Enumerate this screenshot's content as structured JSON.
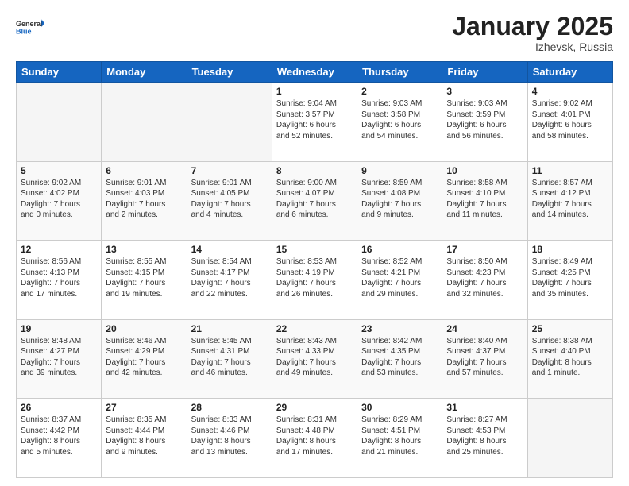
{
  "header": {
    "logo_general": "General",
    "logo_blue": "Blue",
    "month_title": "January 2025",
    "location": "Izhevsk, Russia"
  },
  "weekdays": [
    "Sunday",
    "Monday",
    "Tuesday",
    "Wednesday",
    "Thursday",
    "Friday",
    "Saturday"
  ],
  "weeks": [
    [
      {
        "day": "",
        "info": "",
        "empty": true
      },
      {
        "day": "",
        "info": "",
        "empty": true
      },
      {
        "day": "",
        "info": "",
        "empty": true
      },
      {
        "day": "1",
        "info": "Sunrise: 9:04 AM\nSunset: 3:57 PM\nDaylight: 6 hours\nand 52 minutes."
      },
      {
        "day": "2",
        "info": "Sunrise: 9:03 AM\nSunset: 3:58 PM\nDaylight: 6 hours\nand 54 minutes."
      },
      {
        "day": "3",
        "info": "Sunrise: 9:03 AM\nSunset: 3:59 PM\nDaylight: 6 hours\nand 56 minutes."
      },
      {
        "day": "4",
        "info": "Sunrise: 9:02 AM\nSunset: 4:01 PM\nDaylight: 6 hours\nand 58 minutes."
      }
    ],
    [
      {
        "day": "5",
        "info": "Sunrise: 9:02 AM\nSunset: 4:02 PM\nDaylight: 7 hours\nand 0 minutes."
      },
      {
        "day": "6",
        "info": "Sunrise: 9:01 AM\nSunset: 4:03 PM\nDaylight: 7 hours\nand 2 minutes."
      },
      {
        "day": "7",
        "info": "Sunrise: 9:01 AM\nSunset: 4:05 PM\nDaylight: 7 hours\nand 4 minutes."
      },
      {
        "day": "8",
        "info": "Sunrise: 9:00 AM\nSunset: 4:07 PM\nDaylight: 7 hours\nand 6 minutes."
      },
      {
        "day": "9",
        "info": "Sunrise: 8:59 AM\nSunset: 4:08 PM\nDaylight: 7 hours\nand 9 minutes."
      },
      {
        "day": "10",
        "info": "Sunrise: 8:58 AM\nSunset: 4:10 PM\nDaylight: 7 hours\nand 11 minutes."
      },
      {
        "day": "11",
        "info": "Sunrise: 8:57 AM\nSunset: 4:12 PM\nDaylight: 7 hours\nand 14 minutes."
      }
    ],
    [
      {
        "day": "12",
        "info": "Sunrise: 8:56 AM\nSunset: 4:13 PM\nDaylight: 7 hours\nand 17 minutes."
      },
      {
        "day": "13",
        "info": "Sunrise: 8:55 AM\nSunset: 4:15 PM\nDaylight: 7 hours\nand 19 minutes."
      },
      {
        "day": "14",
        "info": "Sunrise: 8:54 AM\nSunset: 4:17 PM\nDaylight: 7 hours\nand 22 minutes."
      },
      {
        "day": "15",
        "info": "Sunrise: 8:53 AM\nSunset: 4:19 PM\nDaylight: 7 hours\nand 26 minutes."
      },
      {
        "day": "16",
        "info": "Sunrise: 8:52 AM\nSunset: 4:21 PM\nDaylight: 7 hours\nand 29 minutes."
      },
      {
        "day": "17",
        "info": "Sunrise: 8:50 AM\nSunset: 4:23 PM\nDaylight: 7 hours\nand 32 minutes."
      },
      {
        "day": "18",
        "info": "Sunrise: 8:49 AM\nSunset: 4:25 PM\nDaylight: 7 hours\nand 35 minutes."
      }
    ],
    [
      {
        "day": "19",
        "info": "Sunrise: 8:48 AM\nSunset: 4:27 PM\nDaylight: 7 hours\nand 39 minutes."
      },
      {
        "day": "20",
        "info": "Sunrise: 8:46 AM\nSunset: 4:29 PM\nDaylight: 7 hours\nand 42 minutes."
      },
      {
        "day": "21",
        "info": "Sunrise: 8:45 AM\nSunset: 4:31 PM\nDaylight: 7 hours\nand 46 minutes."
      },
      {
        "day": "22",
        "info": "Sunrise: 8:43 AM\nSunset: 4:33 PM\nDaylight: 7 hours\nand 49 minutes."
      },
      {
        "day": "23",
        "info": "Sunrise: 8:42 AM\nSunset: 4:35 PM\nDaylight: 7 hours\nand 53 minutes."
      },
      {
        "day": "24",
        "info": "Sunrise: 8:40 AM\nSunset: 4:37 PM\nDaylight: 7 hours\nand 57 minutes."
      },
      {
        "day": "25",
        "info": "Sunrise: 8:38 AM\nSunset: 4:40 PM\nDaylight: 8 hours\nand 1 minute."
      }
    ],
    [
      {
        "day": "26",
        "info": "Sunrise: 8:37 AM\nSunset: 4:42 PM\nDaylight: 8 hours\nand 5 minutes."
      },
      {
        "day": "27",
        "info": "Sunrise: 8:35 AM\nSunset: 4:44 PM\nDaylight: 8 hours\nand 9 minutes."
      },
      {
        "day": "28",
        "info": "Sunrise: 8:33 AM\nSunset: 4:46 PM\nDaylight: 8 hours\nand 13 minutes."
      },
      {
        "day": "29",
        "info": "Sunrise: 8:31 AM\nSunset: 4:48 PM\nDaylight: 8 hours\nand 17 minutes."
      },
      {
        "day": "30",
        "info": "Sunrise: 8:29 AM\nSunset: 4:51 PM\nDaylight: 8 hours\nand 21 minutes."
      },
      {
        "day": "31",
        "info": "Sunrise: 8:27 AM\nSunset: 4:53 PM\nDaylight: 8 hours\nand 25 minutes."
      },
      {
        "day": "",
        "info": "",
        "empty": true
      }
    ]
  ]
}
